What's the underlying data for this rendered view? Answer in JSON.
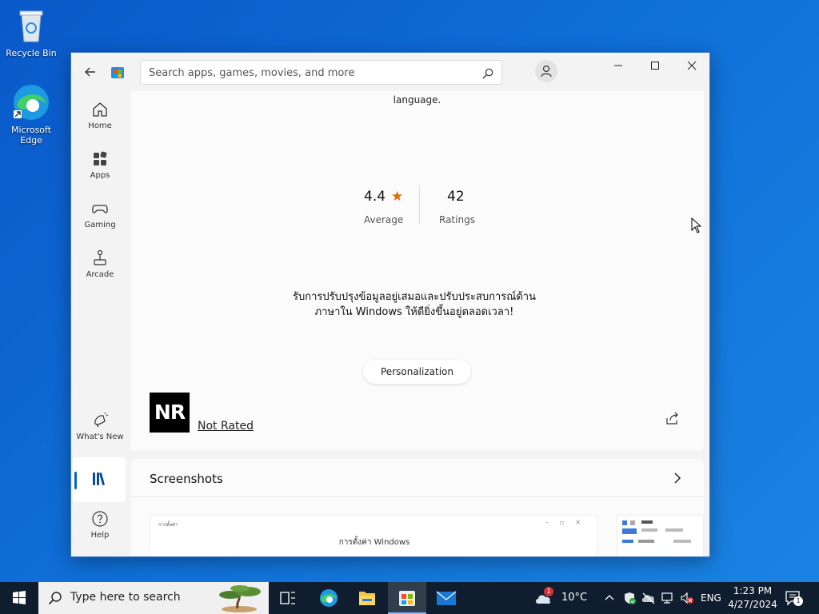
{
  "desktop": {
    "icons": [
      {
        "label": "Recycle Bin"
      },
      {
        "label": "Microsoft Edge"
      }
    ]
  },
  "search": {
    "placeholder": "Search apps, games, movies, and more"
  },
  "nav": {
    "items": [
      {
        "label": "Home",
        "icon": "home-icon"
      },
      {
        "label": "Apps",
        "icon": "apps-icon"
      },
      {
        "label": "Gaming",
        "icon": "gaming-icon"
      },
      {
        "label": "Arcade",
        "icon": "arcade-icon"
      },
      {
        "label": "What's New",
        "icon": "whats-new-icon"
      },
      {
        "label": "",
        "icon": "library-icon"
      },
      {
        "label": "Help",
        "icon": "help-icon"
      }
    ]
  },
  "app": {
    "lang_text": "language.",
    "rating": {
      "value": "4.4",
      "label": "Average",
      "count": "42",
      "count_label": "Ratings"
    },
    "description_line1": "รับการปรับปรุงข้อมูลอยู่เสมอและปรับประสบการณ์ด้าน",
    "description_line2": "ภาษาใน Windows ให้ดียิ่งขึ้นอยู่ตลอดเวลา!",
    "category": "Personalization",
    "age_badge": "NR",
    "age_label": "Not Rated"
  },
  "screenshots": {
    "title": "Screenshots",
    "shot1_caption": "การตั้งค่า",
    "shot1_title": "การตั้งค่า Windows"
  },
  "taskbar": {
    "search_placeholder": "Type here to search",
    "weather": "10°C",
    "weather_badge": "1",
    "lang": "ENG",
    "time": "1:23 PM",
    "date": "4/27/2024",
    "notif_count": "1"
  },
  "colors": {
    "accent": "#0067c0",
    "star": "#e06c00"
  }
}
